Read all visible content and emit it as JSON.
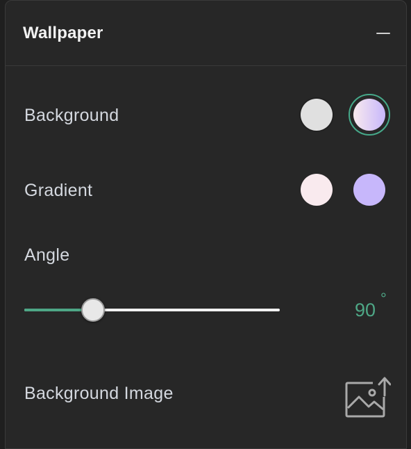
{
  "panel": {
    "title": "Wallpaper",
    "collapse_icon": "minus-icon"
  },
  "background": {
    "label": "Background",
    "options": [
      {
        "name": "solid",
        "color": "#e0e0e0",
        "selected": false
      },
      {
        "name": "gradient",
        "colors": [
          "#f9eaee",
          "#c7b7fb"
        ],
        "selected": true
      }
    ]
  },
  "gradient": {
    "label": "Gradient",
    "start_color": "#f9eaee",
    "end_color": "#c7b7fb"
  },
  "angle": {
    "label": "Angle",
    "value": "90",
    "unit": "°",
    "slider_fraction": 0.27,
    "accent": "#4ea786"
  },
  "background_image": {
    "label": "Background Image",
    "icon": "image-upload-icon"
  }
}
